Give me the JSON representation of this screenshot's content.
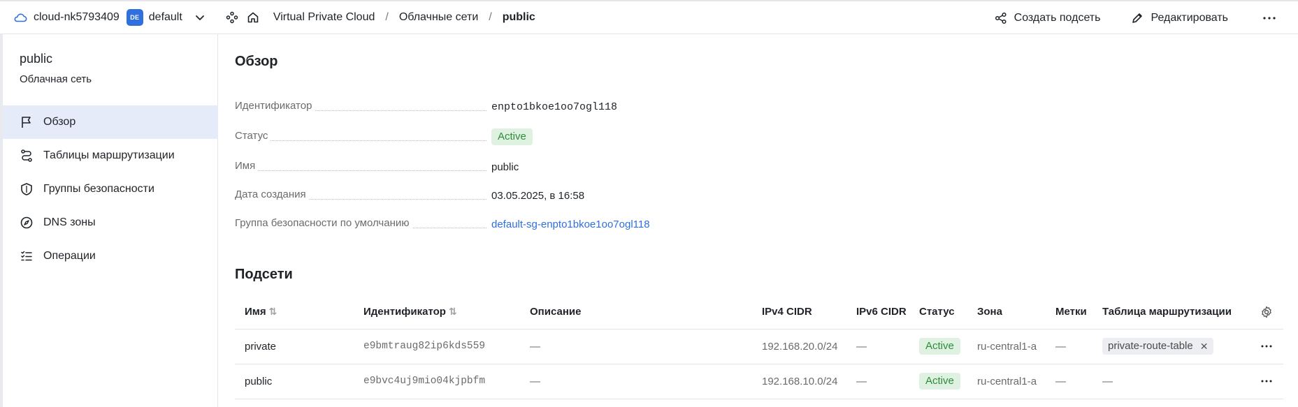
{
  "topbar": {
    "cloud_name": "cloud-nk5793409",
    "folder_badge": "DE",
    "folder_name": "default",
    "breadcrumbs": [
      "Virtual Private Cloud",
      "Облачные сети",
      "public"
    ],
    "breadcrumb_sep": "/",
    "actions": {
      "create_subnet": "Создать подсеть",
      "edit": "Редактировать"
    }
  },
  "sidebar": {
    "title": "public",
    "subtitle": "Облачная сеть",
    "items": [
      {
        "label": "Обзор",
        "icon": "flag-icon",
        "active": true
      },
      {
        "label": "Таблицы маршрутизации",
        "icon": "route-icon"
      },
      {
        "label": "Группы безопасности",
        "icon": "shield-icon"
      },
      {
        "label": "DNS зоны",
        "icon": "compass-icon"
      },
      {
        "label": "Операции",
        "icon": "list-icon"
      }
    ]
  },
  "overview": {
    "heading": "Обзор",
    "id_label": "Идентификатор",
    "id_value": "enpto1bkoe1oo7ogl118",
    "status_label": "Статус",
    "status_value": "Active",
    "name_label": "Имя",
    "name_value": "public",
    "created_label": "Дата создания",
    "created_value": "03.05.2025, в 16:58",
    "sg_label": "Группа безопасности по умолчанию",
    "sg_value": "default-sg-enpto1bkoe1oo7ogl118"
  },
  "subnets": {
    "heading": "Подсети",
    "columns": {
      "name": "Имя",
      "id": "Идентификатор",
      "description": "Описание",
      "ipv4": "IPv4 CIDR",
      "ipv6": "IPv6 CIDR",
      "status": "Статус",
      "zone": "Зона",
      "labels": "Метки",
      "route_table": "Таблица маршрутизации"
    },
    "rows": [
      {
        "name": "private",
        "id": "e9bmtraug82ip6kds559",
        "description": "—",
        "ipv4": "192.168.20.0/24",
        "ipv6": "—",
        "status": "Active",
        "zone": "ru-central1-a",
        "labels": "—",
        "route_table": "private-route-table"
      },
      {
        "name": "public",
        "id": "e9bvc4uj9mio04kjpbfm",
        "description": "—",
        "ipv4": "192.168.10.0/24",
        "ipv6": "—",
        "status": "Active",
        "zone": "ru-central1-a",
        "labels": "—",
        "route_table": "—"
      }
    ]
  },
  "colors": {
    "accent": "#2f6fde",
    "active_bg": "#dff2e2",
    "active_text": "#2e8a3a",
    "sidebar_active": "#e6ebfa"
  }
}
